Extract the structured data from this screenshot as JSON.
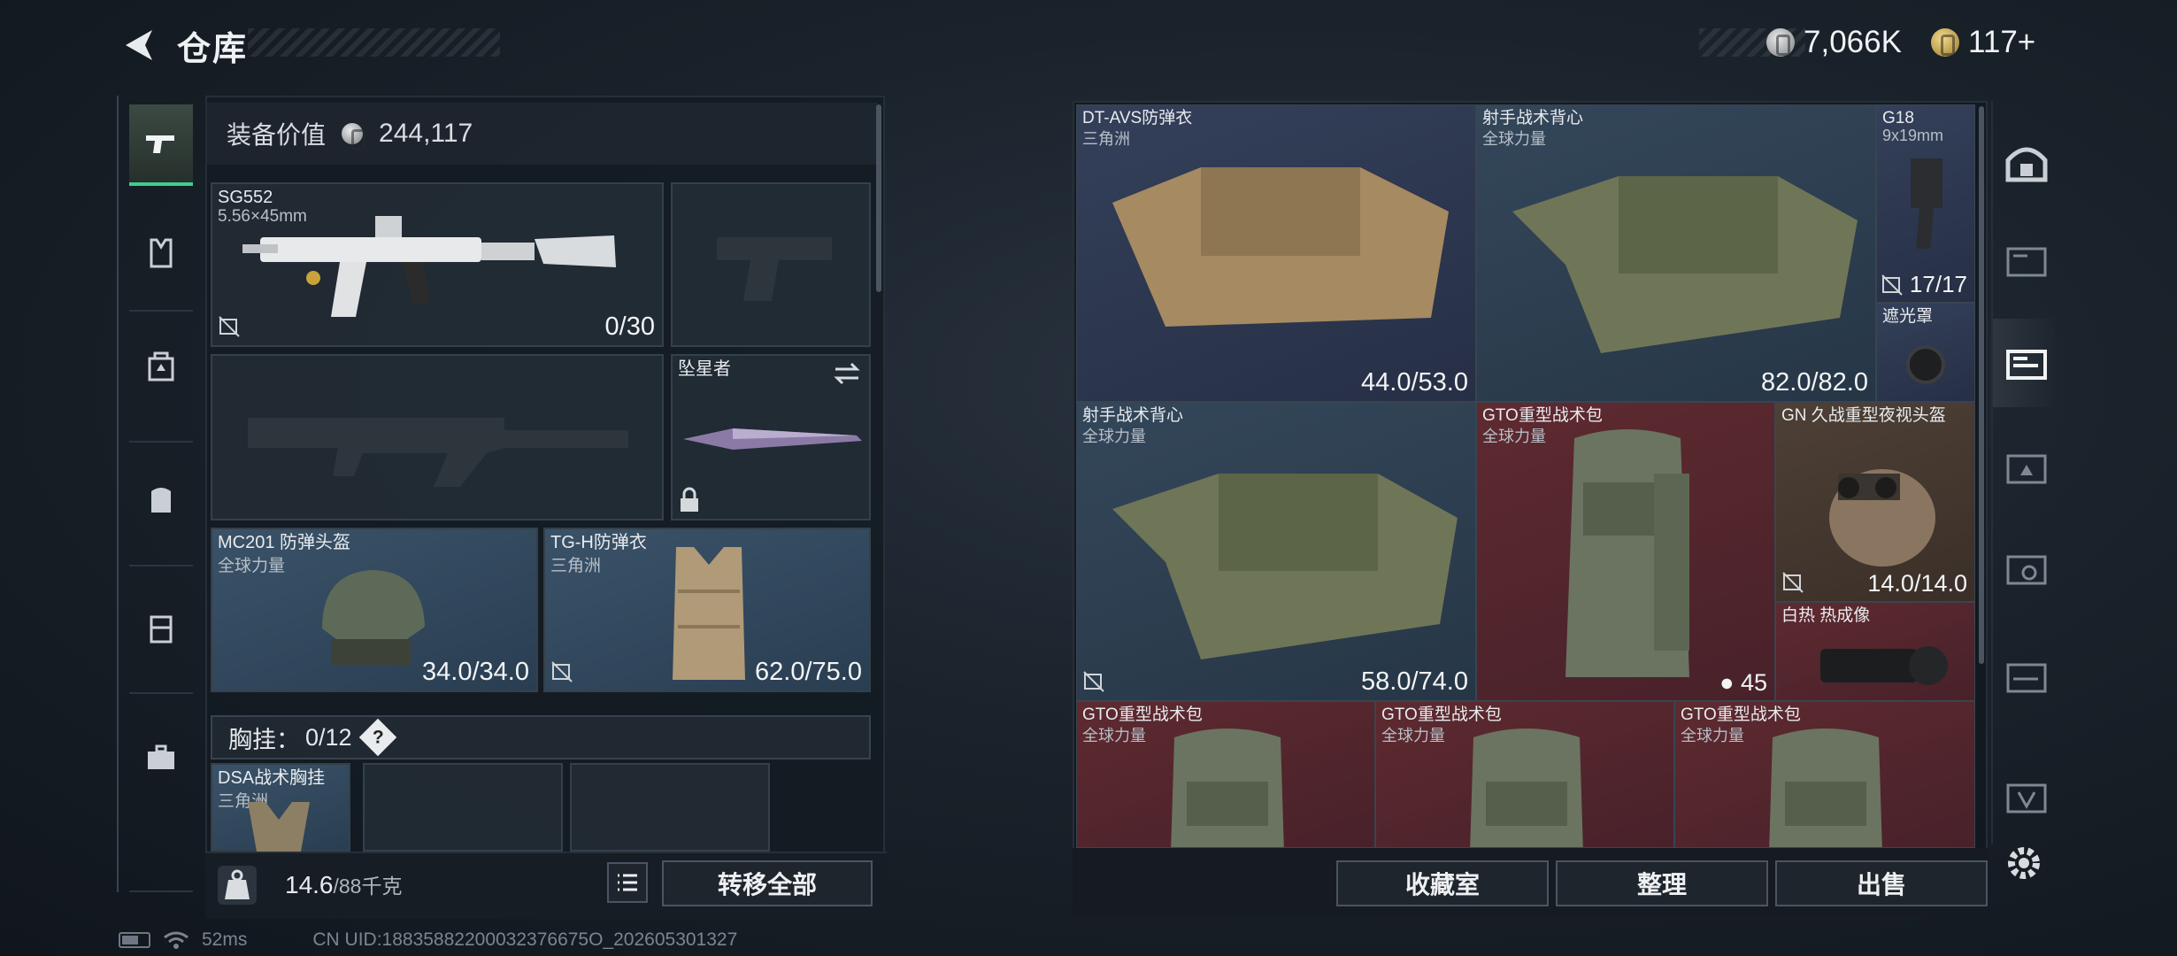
{
  "header": {
    "title": "仓库"
  },
  "currency": [
    {
      "value": "7,066K",
      "icon": "silver-coin-icon"
    },
    {
      "value": "117+",
      "icon": "gold-coin-icon"
    }
  ],
  "left_sidebar": {
    "items": [
      {
        "icon": "pistol-icon",
        "active": true
      },
      {
        "icon": "vest-icon"
      },
      {
        "icon": "chest-rig-icon"
      },
      {
        "icon": "backpack-icon"
      },
      {
        "icon": "tool-case-icon"
      },
      {
        "icon": "briefcase-icon"
      }
    ]
  },
  "loadout": {
    "equip_value_label": "装备价值",
    "equip_value": "244,117",
    "primary": {
      "name": "SG552",
      "sub": "5.56×45mm",
      "ammo": "0/30"
    },
    "melee": {
      "name": "坠星者"
    },
    "helmet": {
      "name": "MC201 防弹头盔",
      "sub": "全球力量",
      "durability": "34.0/34.0"
    },
    "armor": {
      "name": "TG-H防弹衣",
      "sub": "三角洲",
      "durability": "62.0/75.0"
    },
    "chest_rig_label": "胸挂：",
    "chest_rig_count": "0/12",
    "chest_rig_help": "?",
    "chest_rig_item": {
      "name": "DSA战术胸挂",
      "sub": "三角洲"
    },
    "weight_value": "14.6",
    "weight_max": "/88千克",
    "transfer_all": "转移全部"
  },
  "stash": {
    "items": [
      {
        "name": "DT-AVS防弹衣",
        "sub": "三角洲",
        "durability": "44.0/53.0"
      },
      {
        "name": "射手战术背心",
        "sub": "全球力量",
        "durability": "82.0/82.0"
      },
      {
        "name": "G18",
        "sub": "9x19mm",
        "ammo": "17/17"
      },
      {
        "name": "遮光罩"
      },
      {
        "name": "射手战术背心",
        "sub": "全球力量",
        "durability": "58.0/74.0"
      },
      {
        "name": "GTO重型战术包",
        "sub": "全球力量",
        "count": "45"
      },
      {
        "name": "GN 久战重型夜视头盔",
        "durability": "14.0/14.0"
      },
      {
        "name": "白热 热成像"
      },
      {
        "name": "GTO重型战术包",
        "sub": "全球力量"
      },
      {
        "name": "GTO重型战术包",
        "sub": "全球力量"
      },
      {
        "name": "GTO重型战术包",
        "sub": "全球力量"
      }
    ],
    "buttons": {
      "collection": "收藏室",
      "organize": "整理",
      "sell": "出售"
    }
  },
  "right_sidebar": {
    "items": [
      {
        "icon": "home-icon"
      },
      {
        "icon": "stash-tab-iv-icon"
      },
      {
        "icon": "stash-tab-gti-icon",
        "active": true
      },
      {
        "icon": "stash-tab-gti-2-icon"
      },
      {
        "icon": "stash-tab-gti-3-icon"
      },
      {
        "icon": "stash-tab-gti-4-icon"
      },
      {
        "icon": "stash-tab-v-icon"
      }
    ]
  },
  "status": {
    "ping": "52ms",
    "uid": "CN UID:18835882200032376675O_202605301327"
  }
}
